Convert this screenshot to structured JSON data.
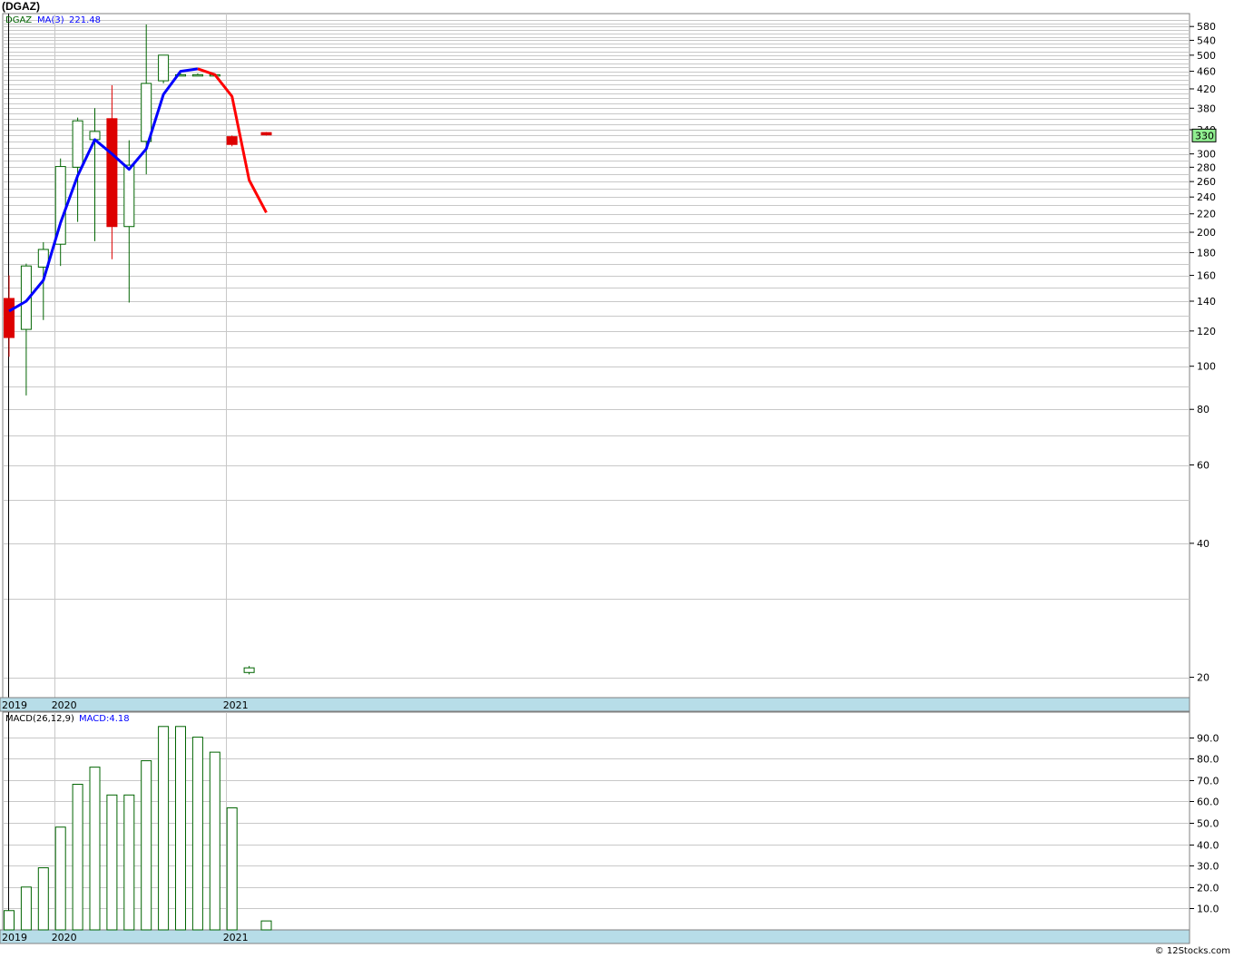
{
  "title": "(DGAZ)",
  "credit": "© 12Stocks.com",
  "colors": {
    "up": "#006400",
    "down": "#dd0000",
    "ma_up": "#0000ff",
    "ma_down": "#ff0000",
    "grid": "#c8c8c8",
    "axis_band": "#b7dde8",
    "price_tag": "#90ee90"
  },
  "chart_data": [
    {
      "type": "candlestick",
      "symbol": "DGAZ",
      "legend": {
        "symbol": "DGAZ",
        "ma_label": "MA(3)",
        "ma_value": "221.48"
      },
      "y_scale": "log",
      "ylim": [
        18,
        620
      ],
      "y_ticks": [
        20,
        40,
        60,
        80,
        100,
        120,
        140,
        160,
        180,
        200,
        220,
        240,
        260,
        280,
        300,
        340,
        380,
        420,
        460,
        500,
        540,
        580
      ],
      "y_gridlines": [
        20,
        30,
        40,
        50,
        60,
        70,
        80,
        90,
        100,
        110,
        120,
        130,
        140,
        150,
        160,
        170,
        180,
        190,
        200,
        210,
        220,
        230,
        240,
        250,
        260,
        270,
        280,
        290,
        300,
        310,
        320,
        330,
        340,
        350,
        360,
        370,
        380,
        390,
        400,
        410,
        420,
        430,
        440,
        450,
        460,
        470,
        480,
        490,
        500,
        510,
        520,
        530,
        540,
        550,
        560,
        570,
        580,
        590,
        600
      ],
      "last_price": "330",
      "x_labels": [
        {
          "label": "2019",
          "index": -0.35
        },
        {
          "label": "2020",
          "index": 3
        },
        {
          "label": "2021",
          "index": 13
        }
      ],
      "candles": [
        {
          "open": 142,
          "high": 160,
          "low": 105,
          "close": 116
        },
        {
          "open": 121,
          "high": 170,
          "low": 86,
          "close": 168
        },
        {
          "open": 167,
          "high": 190,
          "low": 127,
          "close": 183
        },
        {
          "open": 188,
          "high": 293,
          "low": 168,
          "close": 281
        },
        {
          "open": 280,
          "high": 362,
          "low": 211,
          "close": 356
        },
        {
          "open": 323,
          "high": 380,
          "low": 191,
          "close": 337
        },
        {
          "open": 360,
          "high": 428,
          "low": 174,
          "close": 206
        },
        {
          "open": 206,
          "high": 322,
          "low": 139,
          "close": 283
        },
        {
          "open": 320,
          "high": 586,
          "low": 270,
          "close": 432
        },
        {
          "open": 438,
          "high": 500,
          "low": 432,
          "close": 500
        },
        {
          "open": 452,
          "high": 455,
          "low": 450,
          "close": 452
        },
        {
          "open": 452,
          "high": 455,
          "low": 450,
          "close": 452
        },
        {
          "open": 452,
          "high": 455,
          "low": 450,
          "close": 452
        },
        {
          "open": 328,
          "high": 330,
          "low": 312,
          "close": 315
        },
        {
          "open": 20.5,
          "high": 21.2,
          "low": 20.3,
          "close": 21.0
        },
        {
          "open": 335,
          "high": 336,
          "low": 330,
          "close": 331
        }
      ],
      "ma": [
        133,
        140,
        156,
        210,
        268,
        323,
        300,
        277,
        308,
        408,
        460,
        466,
        452,
        404,
        262,
        221.48
      ],
      "ma_down_from": 11
    },
    {
      "type": "bar",
      "indicator": "MACD",
      "legend": {
        "label": "MACD(26,12,9)",
        "value_label": "MACD:4.18"
      },
      "ylim": [
        0,
        100
      ],
      "y_ticks": [
        "10.0",
        "20.0",
        "30.0",
        "40.0",
        "50.0",
        "60.0",
        "70.0",
        "80.0",
        "90.0"
      ],
      "x_labels": [
        {
          "label": "2019",
          "index": -0.35
        },
        {
          "label": "2020",
          "index": 3
        },
        {
          "label": "2021",
          "index": 13
        }
      ],
      "values": [
        9,
        20,
        29,
        48,
        68,
        76,
        63,
        63,
        79,
        95,
        95,
        90,
        83,
        57,
        null,
        4.18
      ]
    }
  ]
}
